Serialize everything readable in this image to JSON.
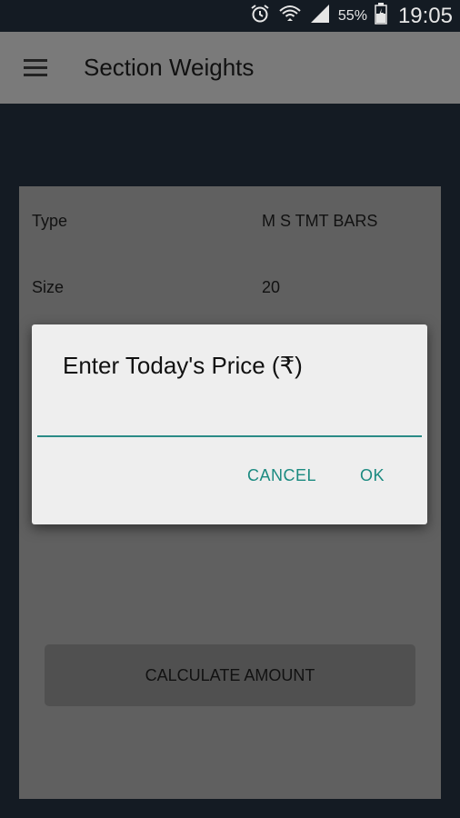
{
  "status_bar": {
    "battery_percent": "55%",
    "time": "19:05",
    "icons": [
      "alarm-icon",
      "wifi-icon",
      "signal-icon",
      "battery-icon"
    ]
  },
  "app_bar": {
    "title": "Section Weights",
    "menu_icon": "hamburger-menu-icon"
  },
  "form": {
    "rows": [
      {
        "label": "Type",
        "value": "M S TMT BARS"
      },
      {
        "label": "Size",
        "value": "20"
      }
    ],
    "calculate_button": "CALCULATE AMOUNT"
  },
  "dialog": {
    "title": "Enter Today's Price (₹)",
    "input_value": "",
    "cancel": "CANCEL",
    "ok": "OK"
  },
  "colors": {
    "accent": "#1b8a80",
    "app_bar": "#7a7a7a",
    "background": "#141b23",
    "card": "#606060",
    "dialog": "#eeeeee"
  }
}
